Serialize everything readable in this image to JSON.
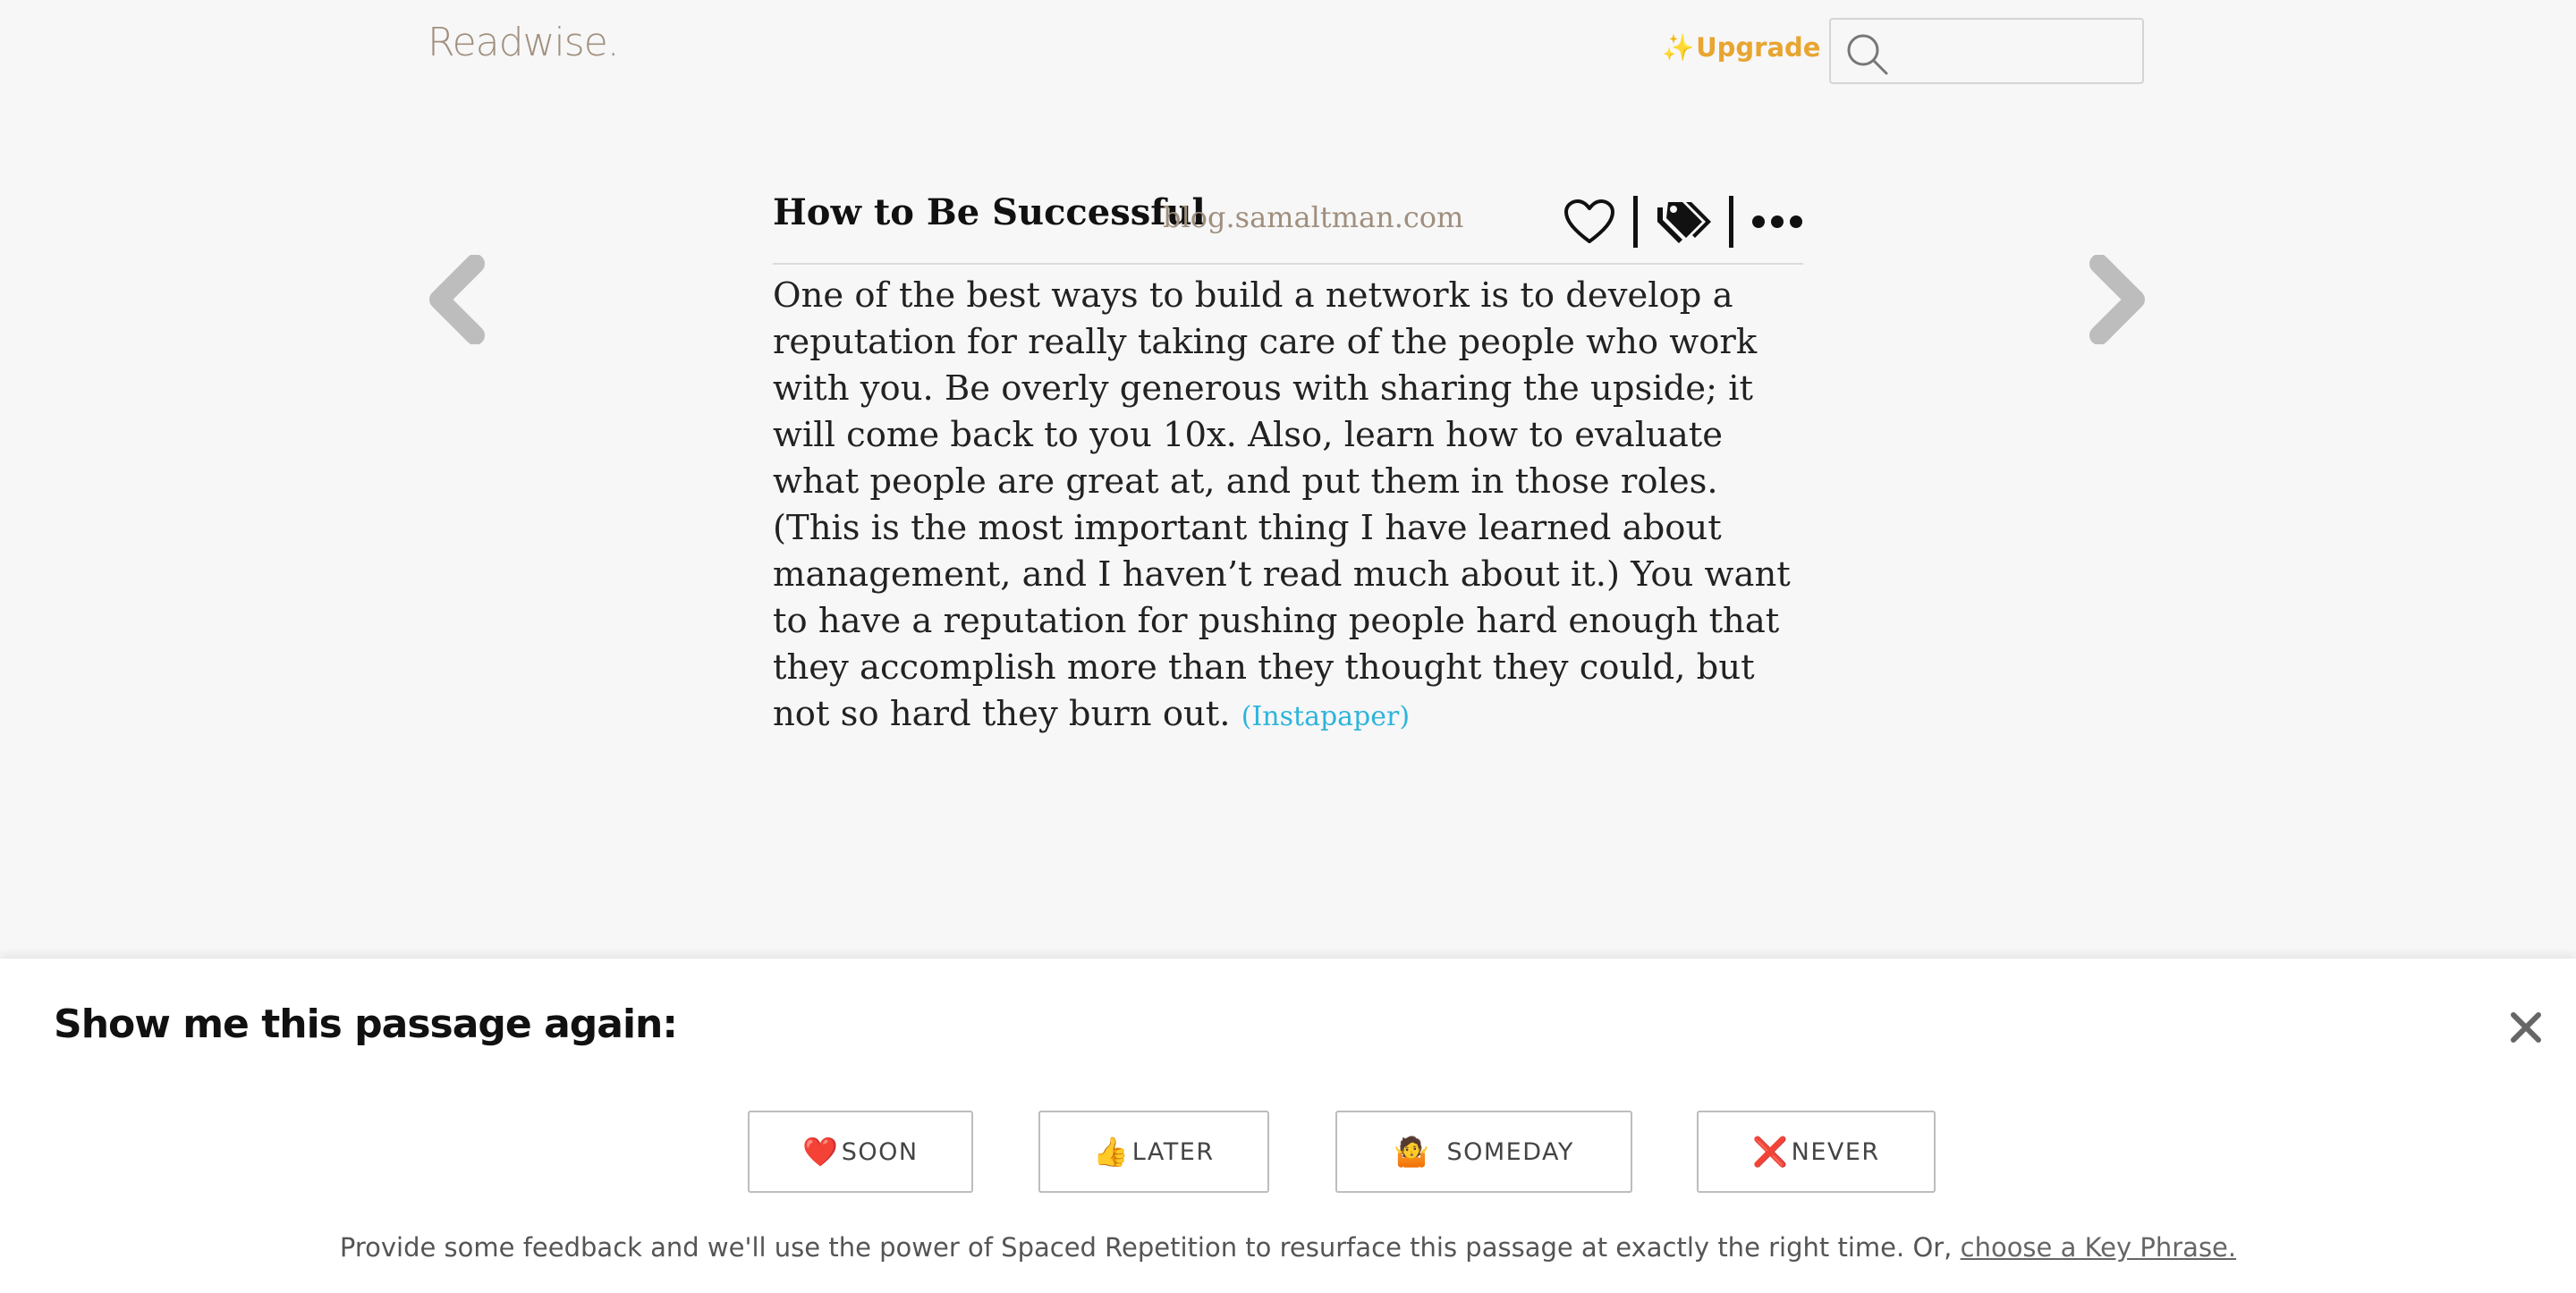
{
  "header": {
    "logo": "Readwise.",
    "upgrade_icon": "sparkles-icon",
    "upgrade_label": "Upgrade",
    "search_placeholder": "",
    "search_value": ""
  },
  "highlight": {
    "title": "How to Be Successful",
    "source": "blog.samaltman.com",
    "actions": [
      "favorite-heart-icon",
      "tags-icon",
      "more-options-icon"
    ],
    "text": "One of the best ways to build a network is to develop a reputation for really taking care of the people who work with you. Be overly generous with sharing the upside; it will come back to you 10x. Also, learn how to evaluate what people are great at, and put them in those roles. (This is the most important thing I have learned about management, and I haven’t read much about it.) You want to have a reputation for pushing people hard enough that they accomplish more than they thought they could, but not so hard they burn out.",
    "source_link": "(Instapaper)"
  },
  "navigation": {
    "prev_icon": "chevron-left-icon",
    "next_icon": "chevron-right-icon"
  },
  "feedback": {
    "title": "Show me this passage again:",
    "close_icon": "close-icon",
    "buttons": [
      {
        "emoji": "❤️",
        "label": "SOON"
      },
      {
        "emoji": "👍",
        "label": "LATER"
      },
      {
        "emoji": "🤷",
        "label": "SOMEDAY"
      },
      {
        "emoji": "❌",
        "label": "NEVER"
      }
    ],
    "note": "Provide some feedback and we'll use the power of Spaced Repetition to resurface this passage at exactly the right time. Or,",
    "key_phrase_link": "choose a Key Phrase."
  },
  "colors": {
    "background": "#f7f7f7",
    "logo": "#a08f7e",
    "upgrade": "#e8a530",
    "source_link": "#2eb4dc",
    "nav_arrow": "#bdbdbd"
  }
}
